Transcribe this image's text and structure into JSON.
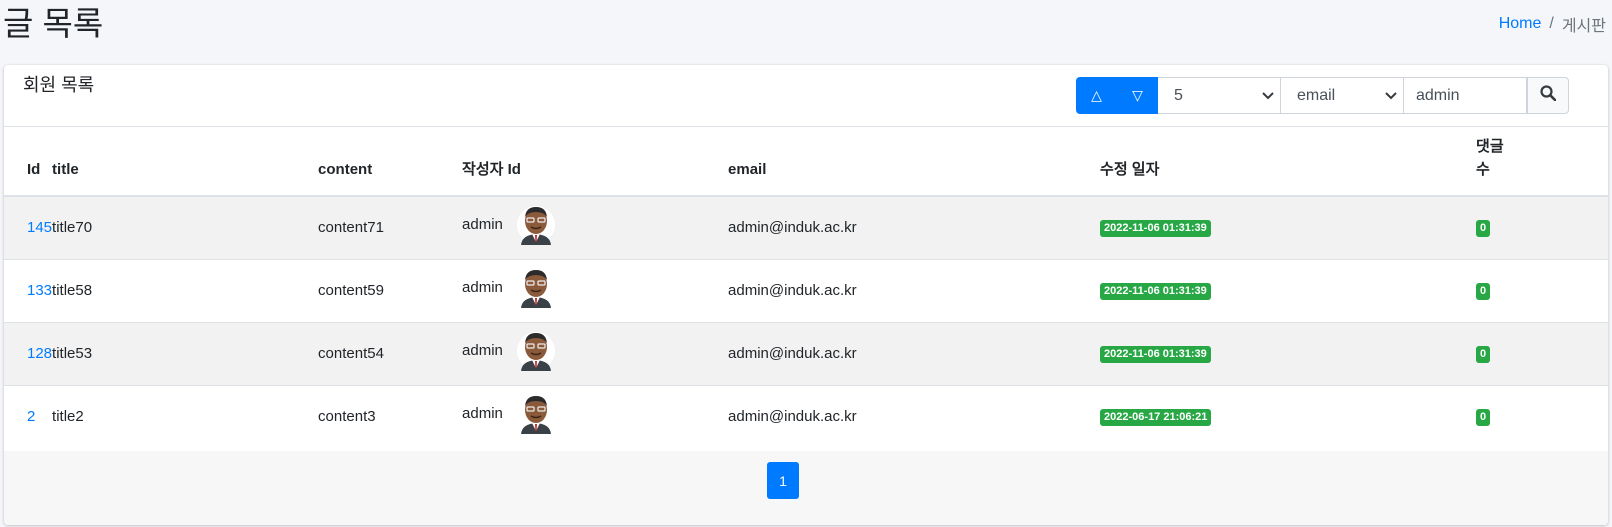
{
  "page": {
    "title": "글 목록",
    "breadcrumb": {
      "home": "Home",
      "separator": "/",
      "current": "게시판"
    }
  },
  "card": {
    "title": "회원 목록",
    "tools": {
      "sort_asc_icon": "△",
      "sort_desc_icon": "▽",
      "rows_select_value": "5",
      "field_select_value": "email",
      "search_value": "admin",
      "search_icon": "search-icon"
    }
  },
  "table": {
    "headers": {
      "id": "Id",
      "title": "title",
      "content": "content",
      "writer": "작성자 Id",
      "email": "email",
      "modified": "수정 일자",
      "comments_line1": "댓글",
      "comments_line2": "수"
    },
    "rows": [
      {
        "id": "145",
        "title": "title70",
        "content": "content71",
        "writer": "admin",
        "email": "admin@induk.ac.kr",
        "modified": "2022-11-06 01:31:39",
        "comments": "0"
      },
      {
        "id": "133",
        "title": "title58",
        "content": "content59",
        "writer": "admin",
        "email": "admin@induk.ac.kr",
        "modified": "2022-11-06 01:31:39",
        "comments": "0"
      },
      {
        "id": "128",
        "title": "title53",
        "content": "content54",
        "writer": "admin",
        "email": "admin@induk.ac.kr",
        "modified": "2022-11-06 01:31:39",
        "comments": "0"
      },
      {
        "id": "2",
        "title": "title2",
        "content": "content3",
        "writer": "admin",
        "email": "admin@induk.ac.kr",
        "modified": "2022-06-17 21:06:21",
        "comments": "0"
      }
    ]
  },
  "pagination": {
    "current": "1"
  },
  "colors": {
    "primary": "#007bff",
    "badge_green": "#28a745",
    "stripe": "#f2f2f2"
  }
}
